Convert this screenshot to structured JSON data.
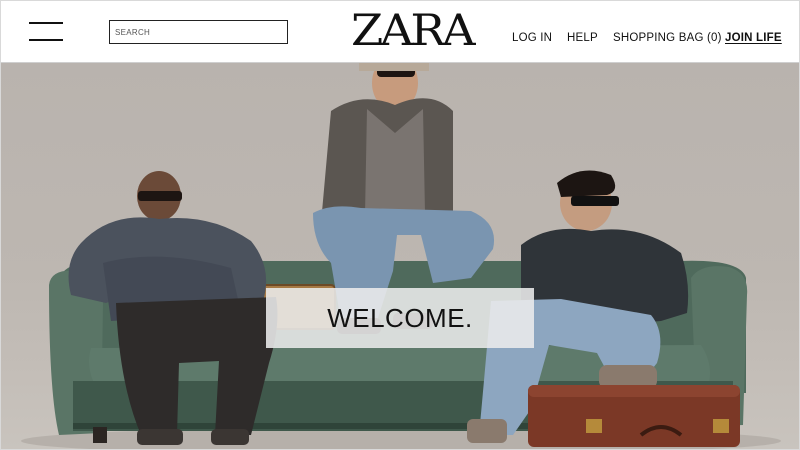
{
  "header": {
    "search_placeholder": "SEARCH",
    "logo": "ZARA",
    "nav": {
      "login": "LOG IN",
      "help": "HELP",
      "bag": "SHOPPING BAG (0)",
      "join": "JOIN LIFE"
    }
  },
  "hero": {
    "welcome": "WELCOME."
  },
  "colors": {
    "brand_text": "#111111",
    "hero_background": "#bdb7b1",
    "sofa": "#4f6a5c"
  }
}
